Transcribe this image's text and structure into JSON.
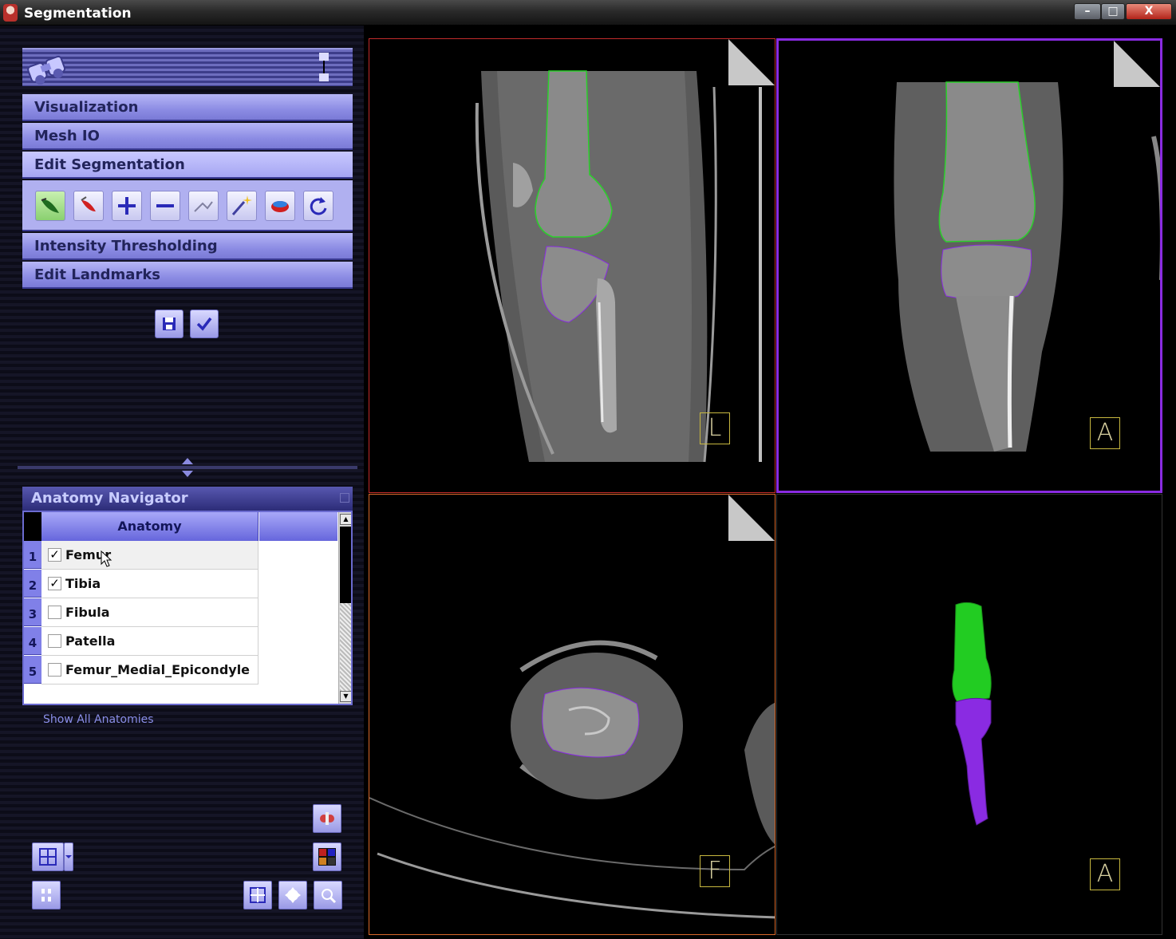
{
  "window": {
    "title": "Segmentation",
    "minimize": "–",
    "maximize": "□",
    "close": "X"
  },
  "accordion": {
    "visualization": "Visualization",
    "mesh_io": "Mesh IO",
    "edit_segmentation": "Edit Segmentation",
    "intensity_thresholding": "Intensity Thresholding",
    "edit_landmarks": "Edit Landmarks"
  },
  "edit_tools": [
    "paint-brush",
    "eraser",
    "add",
    "subtract",
    "line",
    "magic-wand",
    "fill",
    "refresh"
  ],
  "anatomy_navigator": {
    "title": "Anatomy Navigator",
    "column_header": "Anatomy",
    "rows": [
      {
        "num": "1",
        "label": "Femur",
        "checked": true
      },
      {
        "num": "2",
        "label": "Tibia",
        "checked": true
      },
      {
        "num": "3",
        "label": "Fibula",
        "checked": false
      },
      {
        "num": "4",
        "label": "Patella",
        "checked": false
      },
      {
        "num": "5",
        "label": "Femur_Medial_Epicondyle",
        "checked": false
      }
    ],
    "show_all": "Show All Anatomies"
  },
  "viewports": {
    "sagittal_orientation": "L",
    "coronal_orientation": "A",
    "axial_orientation": "F",
    "three_d_orientation": "A"
  },
  "colors": {
    "femur": "#22dd22",
    "tibia": "#8a2be2",
    "sagittal_border": "#c22b2b",
    "coronal_border": "#8a2be2",
    "axial_border": "#d9692a"
  }
}
